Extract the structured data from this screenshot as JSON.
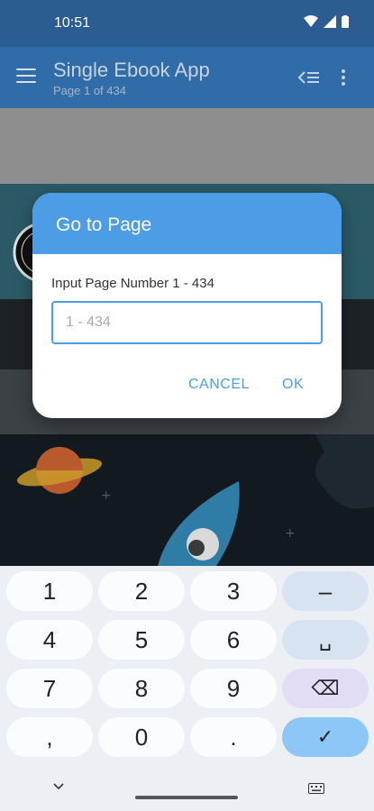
{
  "status_bar": {
    "time": "10:51"
  },
  "app_bar": {
    "title": "Single Ebook App",
    "subtitle": "Page 1 of 434"
  },
  "dialog": {
    "title": "Go to Page",
    "prompt": "Input Page Number 1 - 434",
    "input_placeholder": "1 - 434",
    "input_value": "",
    "cancel_label": "CANCEL",
    "ok_label": "OK"
  },
  "keyboard": {
    "keys": [
      "1",
      "2",
      "3",
      "–",
      "4",
      "5",
      "6",
      "␣",
      "7",
      "8",
      "9",
      "⌫",
      ",",
      "0",
      ".",
      "✓"
    ]
  },
  "colors": {
    "accent": "#4c9de6",
    "app_bar": "#2f6ca8",
    "status_bar": "#2b5d93"
  }
}
